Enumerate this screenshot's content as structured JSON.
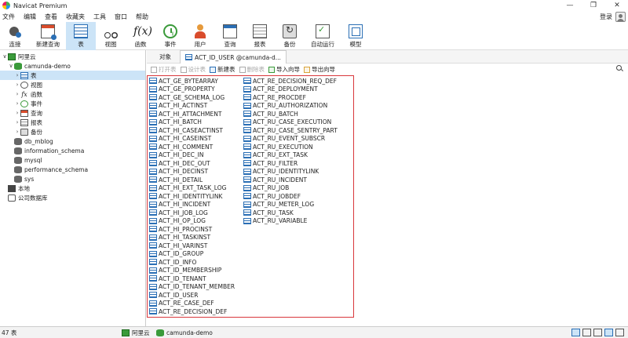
{
  "window": {
    "title": "Navicat Premium",
    "controls": [
      "—",
      "❐",
      "✕"
    ]
  },
  "menu": {
    "items": [
      "文件",
      "编辑",
      "查看",
      "收藏夹",
      "工具",
      "窗口",
      "帮助"
    ],
    "login": "登录"
  },
  "toolbar": {
    "items": [
      {
        "label": "连接",
        "icon": "connect-icon"
      },
      {
        "label": "新建查询",
        "icon": "new-query-icon"
      },
      {
        "label": "表",
        "icon": "table-icon",
        "active": true
      },
      {
        "label": "视图",
        "icon": "view-icon"
      },
      {
        "label": "函数",
        "icon": "function-icon",
        "glyph": "f(x)"
      },
      {
        "label": "事件",
        "icon": "event-icon"
      },
      {
        "label": "用户",
        "icon": "user-icon"
      },
      {
        "label": "查询",
        "icon": "query-icon"
      },
      {
        "label": "报表",
        "icon": "report-icon"
      },
      {
        "label": "备份",
        "icon": "backup-icon"
      },
      {
        "label": "自动运行",
        "icon": "automation-icon"
      },
      {
        "label": "模型",
        "icon": "model-icon"
      }
    ]
  },
  "sidebar": {
    "items": [
      {
        "label": "阿里云",
        "icon": "connection-icon",
        "twisty": "∨"
      },
      {
        "label": "camunda-demo",
        "icon": "database-icon",
        "twisty": "∨"
      },
      {
        "label": "表",
        "icon": "table-icon",
        "twisty": "›",
        "selected": true
      },
      {
        "label": "视图",
        "icon": "view-icon",
        "twisty": "›"
      },
      {
        "label": "函数",
        "icon": "function-icon",
        "twisty": "›"
      },
      {
        "label": "事件",
        "icon": "event-icon",
        "twisty": "›"
      },
      {
        "label": "查询",
        "icon": "query-icon",
        "twisty": "›"
      },
      {
        "label": "报表",
        "icon": "report-icon",
        "twisty": "›"
      },
      {
        "label": "备份",
        "icon": "backup-icon",
        "twisty": "›"
      },
      {
        "label": "db_mblog",
        "icon": "database-icon",
        "twisty": ""
      },
      {
        "label": "information_schema",
        "icon": "database-icon",
        "twisty": ""
      },
      {
        "label": "mysql",
        "icon": "database-icon",
        "twisty": ""
      },
      {
        "label": "performance_schema",
        "icon": "database-icon",
        "twisty": ""
      },
      {
        "label": "sys",
        "icon": "database-icon",
        "twisty": ""
      },
      {
        "label": "本地",
        "icon": "local-connection-icon",
        "twisty": ""
      },
      {
        "label": "公司数据库",
        "icon": "cloud-connection-icon",
        "twisty": ""
      }
    ]
  },
  "tabs": {
    "objects": "对象",
    "active_tab": "ACT_ID_USER @camunda-d..."
  },
  "object_toolbar": {
    "open": "打开表",
    "design": "设计表",
    "new": "新建表",
    "delete": "删除表",
    "import": "导入向导",
    "export": "导出向导"
  },
  "objects": {
    "column1": [
      "ACT_GE_BYTEARRAY",
      "ACT_GE_PROPERTY",
      "ACT_GE_SCHEMA_LOG",
      "ACT_HI_ACTINST",
      "ACT_HI_ATTACHMENT",
      "ACT_HI_BATCH",
      "ACT_HI_CASEACTINST",
      "ACT_HI_CASEINST",
      "ACT_HI_COMMENT",
      "ACT_HI_DEC_IN",
      "ACT_HI_DEC_OUT",
      "ACT_HI_DECINST",
      "ACT_HI_DETAIL",
      "ACT_HI_EXT_TASK_LOG",
      "ACT_HI_IDENTITYLINK",
      "ACT_HI_INCIDENT",
      "ACT_HI_JOB_LOG",
      "ACT_HI_OP_LOG",
      "ACT_HI_PROCINST",
      "ACT_HI_TASKINST",
      "ACT_HI_VARINST",
      "ACT_ID_GROUP",
      "ACT_ID_INFO",
      "ACT_ID_MEMBERSHIP",
      "ACT_ID_TENANT",
      "ACT_ID_TENANT_MEMBER",
      "ACT_ID_USER",
      "ACT_RE_CASE_DEF",
      "ACT_RE_DECISION_DEF"
    ],
    "column2": [
      "ACT_RE_DECISION_REQ_DEF",
      "ACT_RE_DEPLOYMENT",
      "ACT_RE_PROCDEF",
      "ACT_RU_AUTHORIZATION",
      "ACT_RU_BATCH",
      "ACT_RU_CASE_EXECUTION",
      "ACT_RU_CASE_SENTRY_PART",
      "ACT_RU_EVENT_SUBSCR",
      "ACT_RU_EXECUTION",
      "ACT_RU_EXT_TASK",
      "ACT_RU_FILTER",
      "ACT_RU_IDENTITYLINK",
      "ACT_RU_INCIDENT",
      "ACT_RU_JOB",
      "ACT_RU_JOBDEF",
      "ACT_RU_METER_LOG",
      "ACT_RU_TASK",
      "ACT_RU_VARIABLE"
    ]
  },
  "status": {
    "count": "47 表",
    "connection": "阿里云",
    "database": "camunda-demo"
  },
  "colors": {
    "accent": "#2b6fb5",
    "selection": "#cce4f7",
    "highlight_border": "#d9383c"
  }
}
